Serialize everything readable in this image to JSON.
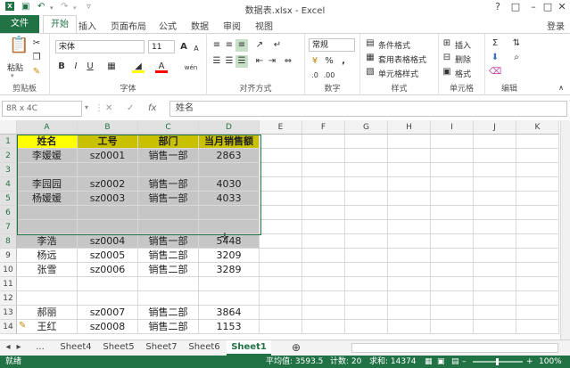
{
  "title": "数据表.xlsx - Excel",
  "tabs": {
    "file": "文件",
    "items": [
      "开始",
      "插入",
      "页面布局",
      "公式",
      "数据",
      "审阅",
      "视图"
    ],
    "login": "登录"
  },
  "ribbon": {
    "clipboard": {
      "label": "剪贴板",
      "paste": "粘贴"
    },
    "font": {
      "label": "字体",
      "name": "宋体",
      "size": "11",
      "grow": "A",
      "shrink": "A",
      "bold": "B",
      "italic": "I",
      "underline": "U",
      "fontcolor": "A",
      "wen": "wén"
    },
    "align": {
      "label": "对齐方式"
    },
    "number": {
      "label": "数字",
      "format": "常规",
      "percent": "%",
      "comma": ","
    },
    "styles": {
      "label": "样式",
      "cond": "条件格式",
      "table": "套用表格格式",
      "cell": "单元格样式"
    },
    "cells": {
      "label": "单元格",
      "insert": "插入",
      "delete": "删除",
      "format": "格式"
    },
    "editing": {
      "label": "编辑",
      "sum": "Σ"
    }
  },
  "formula": {
    "namebox": "8R x 4C",
    "fx": "fx",
    "value": "姓名"
  },
  "columns": [
    "A",
    "B",
    "C",
    "D",
    "E",
    "F",
    "G",
    "H",
    "I",
    "J",
    "K"
  ],
  "rows": [
    {
      "n": "1",
      "cells": [
        "姓名",
        "工号",
        "部门",
        "当月销售额"
      ]
    },
    {
      "n": "2",
      "cells": [
        "李媛媛",
        "sz0001",
        "销售一部",
        "2863"
      ]
    },
    {
      "n": "3",
      "cells": [
        "",
        "",
        "",
        ""
      ]
    },
    {
      "n": "4",
      "cells": [
        "李园园",
        "sz0002",
        "销售一部",
        "4030"
      ]
    },
    {
      "n": "5",
      "cells": [
        "杨媛媛",
        "sz0003",
        "销售一部",
        "4033"
      ]
    },
    {
      "n": "6",
      "cells": [
        "",
        "",
        "",
        ""
      ]
    },
    {
      "n": "7",
      "cells": [
        "",
        "",
        "",
        ""
      ]
    },
    {
      "n": "8",
      "cells": [
        "李浩",
        "sz0004",
        "销售一部",
        "5448"
      ]
    },
    {
      "n": "9",
      "cells": [
        "杨远",
        "sz0005",
        "销售二部",
        "3209"
      ]
    },
    {
      "n": "10",
      "cells": [
        "张雪",
        "sz0006",
        "销售二部",
        "3289"
      ]
    },
    {
      "n": "11",
      "cells": [
        "",
        "",
        "",
        ""
      ]
    },
    {
      "n": "12",
      "cells": [
        "",
        "",
        "",
        ""
      ]
    },
    {
      "n": "13",
      "cells": [
        "郝丽",
        "sz0007",
        "销售二部",
        "3864"
      ]
    },
    {
      "n": "14",
      "cells": [
        "王红",
        "sz0008",
        "销售二部",
        "1153"
      ]
    }
  ],
  "sheets": {
    "nav": "...",
    "items": [
      "Sheet4",
      "Sheet5",
      "Sheet7",
      "Sheet6",
      "Sheet1"
    ],
    "active": "Sheet1"
  },
  "status": {
    "ready": "就绪",
    "average": "平均值: 3593.5",
    "count": "计数: 20",
    "sum": "求和: 14374",
    "zoom": "100%"
  },
  "colors": {
    "accent": "#217346",
    "header_yellow": "#ffff00",
    "header_olive": "#c9c000",
    "selection": "#c6c6c6"
  }
}
